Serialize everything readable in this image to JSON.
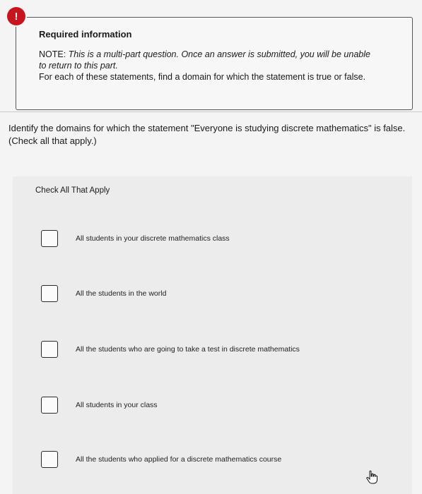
{
  "alert": {
    "icon": "exclamation-alert-icon",
    "glyph": "!"
  },
  "info": {
    "title": "Required information",
    "note_label": "NOTE: ",
    "note_text": "This is a multi-part question. Once an answer is submitted, you will be unable to return to this part.",
    "instruction": "For each of these statements, find a domain for which the statement is true or false."
  },
  "question": "Identify the domains for which the statement \"Everyone is studying discrete mathematics\" is false. (Check all that apply.)",
  "choices_header": "Check All That Apply",
  "choices": [
    {
      "label": "All students in your discrete mathematics class",
      "checked": false
    },
    {
      "label": "All the students in the world",
      "checked": false
    },
    {
      "label": "All the students who are going to take a test in discrete mathematics",
      "checked": false
    },
    {
      "label": "All students in your class",
      "checked": false
    },
    {
      "label": "All the students who applied for a discrete mathematics course",
      "checked": false
    }
  ],
  "cursor": {
    "icon": "hand-pointer-icon"
  },
  "colors": {
    "alert": "#c8141c",
    "background": "#f4f4f4"
  }
}
